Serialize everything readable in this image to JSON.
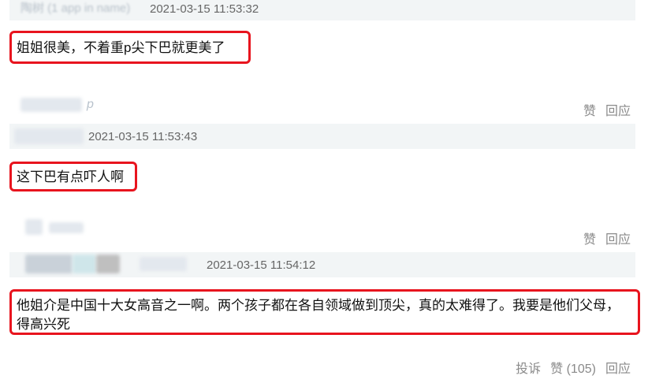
{
  "comments": [
    {
      "username": "陶树 (1 app in name)",
      "timestamp": "2021-03-15 11:53:32",
      "text": "姐姐很美，不着重p尖下巴就更美了",
      "actions": {
        "like": "赞",
        "reply": "回应"
      }
    },
    {
      "username_suffix": "p",
      "timestamp": "2021-03-15 11:53:43",
      "text": "这下巴有点吓人啊",
      "actions": {
        "like": "赞",
        "reply": "回应"
      }
    },
    {
      "timestamp": "2021-03-15 11:54:12",
      "text": "他姐介是中国十大女高音之一啊。两个孩子都在各自领域做到顶尖，真的太难得了。我要是他们父母，得高兴死",
      "actions": {
        "report": "投诉",
        "like": "赞 (105)",
        "reply": "回应"
      }
    }
  ],
  "colors": {
    "highlight_border": "#e8141e",
    "meta_bar": "#f2f5f6",
    "action_text": "#8a8a8a"
  }
}
